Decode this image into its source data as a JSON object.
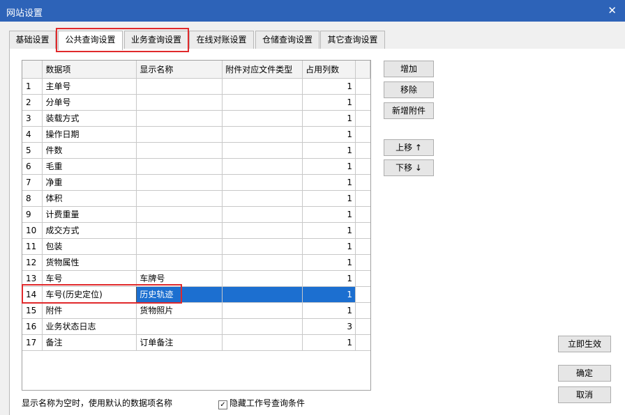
{
  "window": {
    "title": "网站设置",
    "close_glyph": "✕"
  },
  "tabs": [
    "基础设置",
    "公共查询设置",
    "业务查询设置",
    "在线对账设置",
    "仓储查询设置",
    "其它查询设置"
  ],
  "grid": {
    "columns": [
      "",
      "数据项",
      "显示名称",
      "附件对应文件类型",
      "占用列数"
    ],
    "rows": [
      {
        "no": "1",
        "item": "主单号",
        "display": "",
        "type": "",
        "cols": "1"
      },
      {
        "no": "2",
        "item": "分单号",
        "display": "",
        "type": "",
        "cols": "1"
      },
      {
        "no": "3",
        "item": "装载方式",
        "display": "",
        "type": "",
        "cols": "1"
      },
      {
        "no": "4",
        "item": "操作日期",
        "display": "",
        "type": "",
        "cols": "1"
      },
      {
        "no": "5",
        "item": "件数",
        "display": "",
        "type": "",
        "cols": "1"
      },
      {
        "no": "6",
        "item": "毛重",
        "display": "",
        "type": "",
        "cols": "1"
      },
      {
        "no": "7",
        "item": "净重",
        "display": "",
        "type": "",
        "cols": "1"
      },
      {
        "no": "8",
        "item": "体积",
        "display": "",
        "type": "",
        "cols": "1"
      },
      {
        "no": "9",
        "item": "计费重量",
        "display": "",
        "type": "",
        "cols": "1"
      },
      {
        "no": "10",
        "item": "成交方式",
        "display": "",
        "type": "",
        "cols": "1"
      },
      {
        "no": "11",
        "item": "包装",
        "display": "",
        "type": "",
        "cols": "1"
      },
      {
        "no": "12",
        "item": "货物属性",
        "display": "",
        "type": "",
        "cols": "1"
      },
      {
        "no": "13",
        "item": "车号",
        "display": "车牌号",
        "type": "",
        "cols": "1"
      },
      {
        "no": "14",
        "item": "车号(历史定位)",
        "display": "历史轨迹",
        "type": "",
        "cols": "1"
      },
      {
        "no": "15",
        "item": "附件",
        "display": "货物照片",
        "type": "",
        "cols": "1"
      },
      {
        "no": "16",
        "item": "业务状态日志",
        "display": "",
        "type": "",
        "cols": "3"
      },
      {
        "no": "17",
        "item": "备注",
        "display": "订单备注",
        "type": "",
        "cols": "1"
      }
    ]
  },
  "buttons": {
    "add": "增加",
    "remove": "移除",
    "add_attachment": "新增附件",
    "move_up": "上移 ↑",
    "move_down": "下移 ↓",
    "apply": "立即生效",
    "ok": "确定",
    "cancel": "取消"
  },
  "footer": {
    "hint": "显示名称为空时，使用默认的数据项名称",
    "checkbox_label": "隐藏工作号查询条件",
    "checkbox_checked": true,
    "check_glyph": "✓"
  }
}
